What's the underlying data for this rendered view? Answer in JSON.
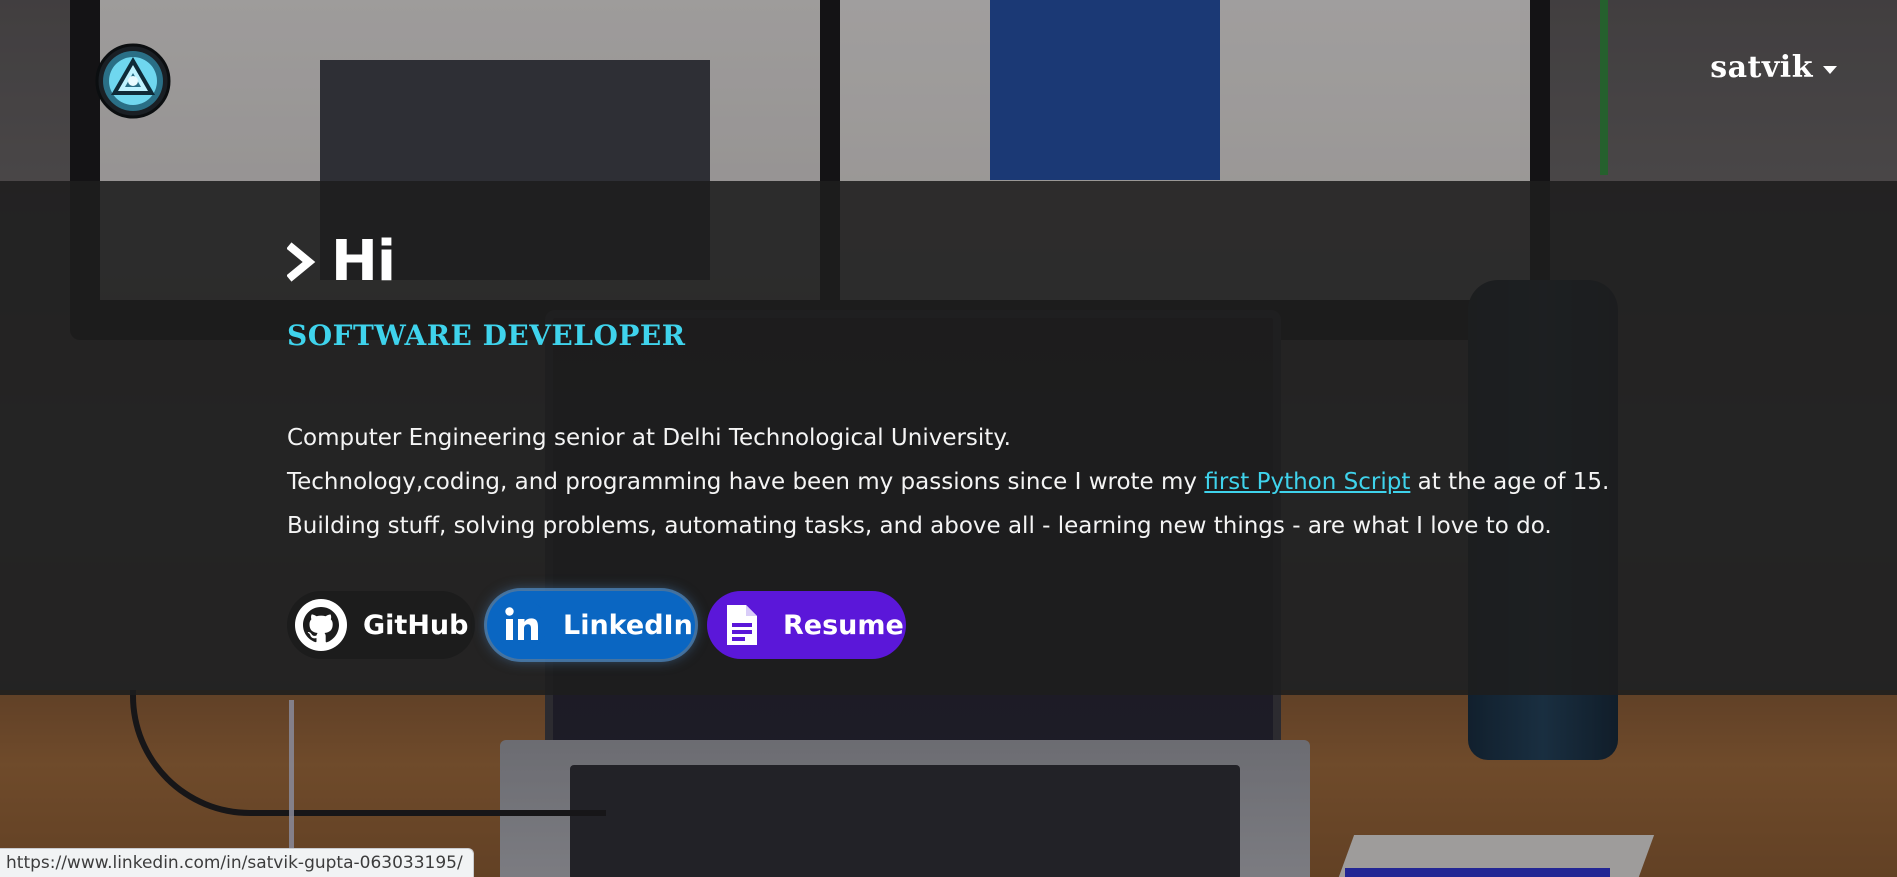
{
  "nav": {
    "logo_icon": "arc-reactor-icon",
    "user_name": "satvik",
    "user_menu_icon": "caret-down-icon"
  },
  "hero": {
    "greeting": "Hi",
    "prompt_icon": "chevron-right-icon",
    "role": "SOFTWARE DEVELOPER",
    "bio": {
      "line1": "Computer Engineering senior at Delhi Technological University.",
      "line2_before": "Technology,coding, and programming have been my passions since I wrote my ",
      "line2_link": "first Python Script",
      "line2_after": " at the age of 15.",
      "line3": "Building stuff, solving problems, automating tasks, and above all - learning new things - are what I love to do."
    },
    "buttons": [
      {
        "label": "GitHub",
        "icon": "github-icon",
        "color": "#1c1c1c"
      },
      {
        "label": "LinkedIn",
        "icon": "linkedin-icon",
        "color": "#0a66c2"
      },
      {
        "label": "Resume",
        "icon": "document-icon",
        "color": "#5b17d9"
      }
    ]
  },
  "status_bar": {
    "url": "https://www.linkedin.com/in/satvik-gupta-063033195/"
  },
  "colors": {
    "accent": "#3fd3ec",
    "overlay": "#1e1e1e"
  }
}
